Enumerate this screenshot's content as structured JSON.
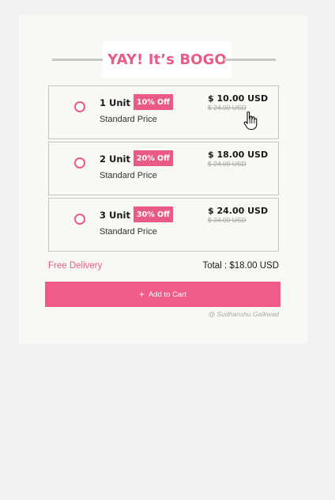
{
  "title": "YAY! It’s BOGO",
  "options": [
    {
      "quantity": "1 Unit",
      "discount": "10% Off",
      "description": "Standard Price",
      "price": "$ 10.00 USD",
      "original_price": "$ 24.00 USD"
    },
    {
      "quantity": "2 Unit",
      "discount": "20% Off",
      "description": "Standard Price",
      "price": "$ 18.00 USD",
      "original_price": "$ 24.00 USD"
    },
    {
      "quantity": "3 Unit",
      "discount": "30% Off",
      "description": "Standard Price",
      "price": "$ 24.00 USD",
      "original_price": "$ 24.00 USD"
    }
  ],
  "delivery": "Free Delivery",
  "total": "Total : $18.00 USD",
  "add_button": {
    "icon": "plus-icon",
    "label": "Add to Cart"
  },
  "credit": "@ Sudhanshu Gaikwad",
  "colors": {
    "accent": "#ea5a86",
    "button": "#f05c87",
    "card": "#f8f8f5",
    "page": "#f0f1f1"
  }
}
